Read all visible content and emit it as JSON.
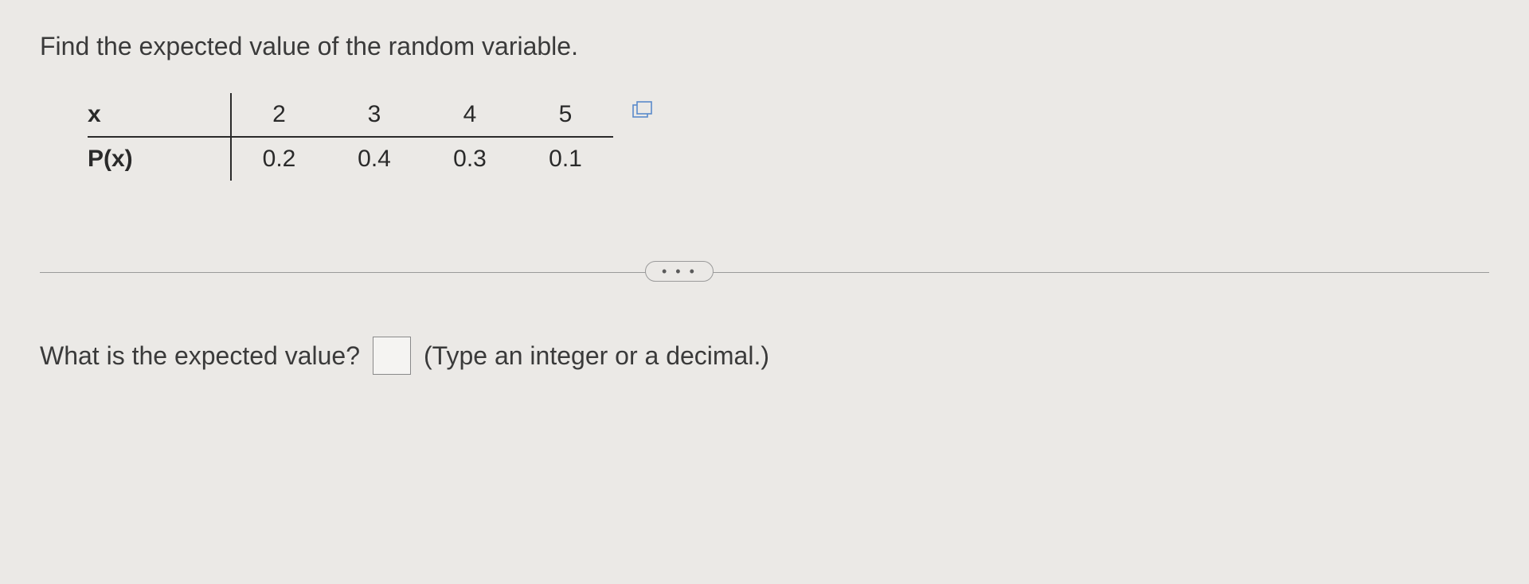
{
  "prompt": "Find the expected value of the random variable.",
  "table": {
    "row_labels": [
      "x",
      "P(x)"
    ],
    "x_values": [
      "2",
      "3",
      "4",
      "5"
    ],
    "p_values": [
      "0.2",
      "0.4",
      "0.3",
      "0.1"
    ]
  },
  "ellipsis": "• • •",
  "question": {
    "label": "What is the expected value?",
    "value": "",
    "hint": "(Type an integer or a decimal.)"
  }
}
